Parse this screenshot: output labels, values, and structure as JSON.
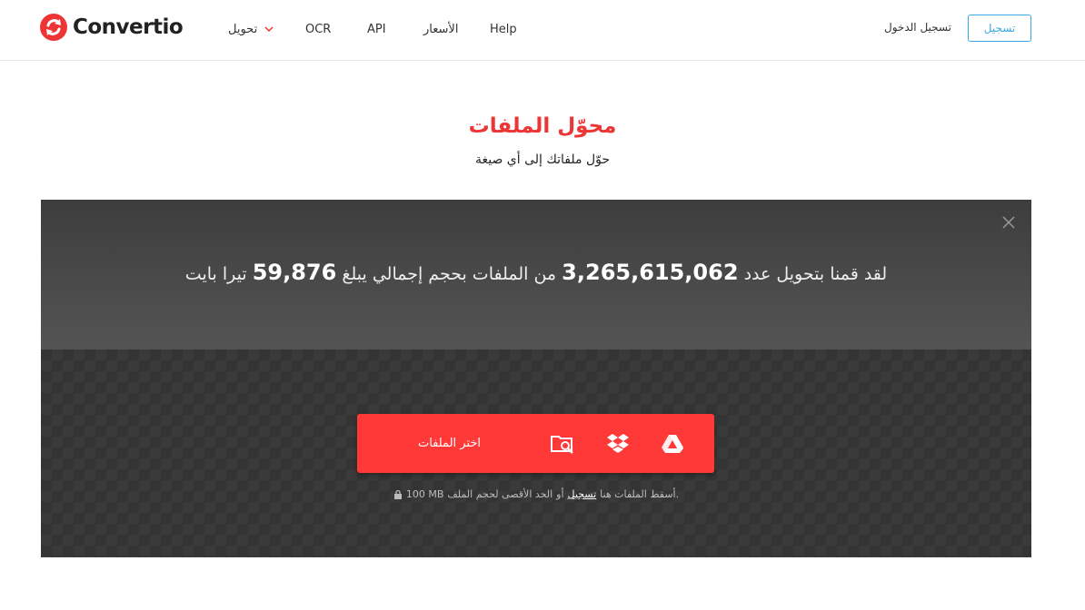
{
  "header": {
    "logo_text": "Convertio",
    "nav": {
      "convert": "تحويل",
      "ocr": "OCR",
      "api": "API",
      "prices": "الأسعار",
      "help": "Help"
    },
    "login": "تسجيل الدخول",
    "signup": "تسجيل"
  },
  "hero": {
    "title": "محوّل الملفات",
    "subtitle": "حوّل ملفاتك إلى أي صيغة"
  },
  "stats": {
    "prefix": "لقد قمنا بتحويل عدد",
    "files_count": "3,265,615,062",
    "middle": "من الملفات بحجم إجمالي يبلغ",
    "total_size": "59,876",
    "suffix": "تيرا بايت"
  },
  "upload": {
    "choose_files": "اختر الملفات",
    "limit_prefix": "الحد الأقصى لحجم الملف",
    "limit_value": "100 MB",
    "limit_or": "أو",
    "limit_signup": "تسجيل",
    "drop_hint": "أسقط الملفات هنا."
  },
  "colors": {
    "brand_red": "#ff3838",
    "title_red": "#ee3535",
    "signup_blue": "#3ba8e0"
  }
}
